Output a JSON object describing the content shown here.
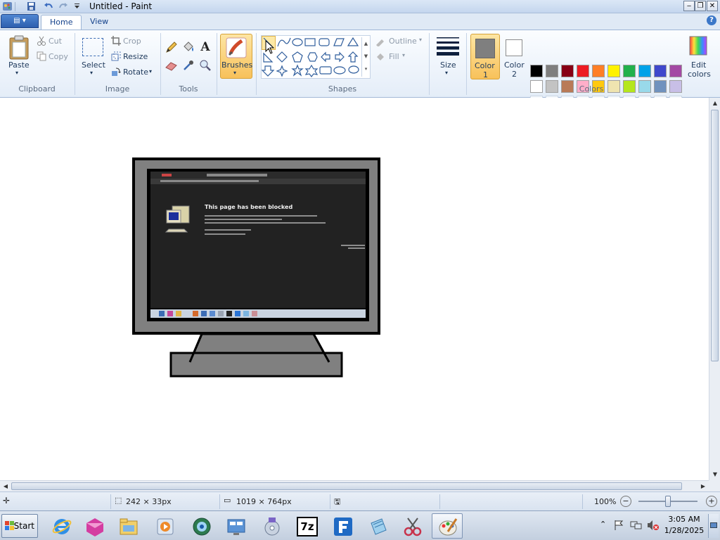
{
  "window": {
    "title": "Untitled - Paint"
  },
  "quick_access": [
    "save-icon",
    "undo-icon",
    "redo-icon",
    "customize-icon"
  ],
  "window_controls": [
    "minimize-icon",
    "restore-icon",
    "close-icon"
  ],
  "tabs": [
    {
      "label": "Home"
    },
    {
      "label": "View"
    }
  ],
  "ribbon": {
    "clipboard": {
      "label": "Clipboard",
      "paste": "Paste",
      "cut": "Cut",
      "copy": "Copy"
    },
    "image": {
      "label": "Image",
      "select": "Select",
      "crop": "Crop",
      "resize": "Resize",
      "rotate": "Rotate"
    },
    "tools": {
      "label": "Tools"
    },
    "brushes": {
      "label": "Brushes"
    },
    "shapes": {
      "label": "Shapes",
      "outline": "Outline",
      "fill": "Fill"
    },
    "size": {
      "label": "Size"
    },
    "colors": {
      "label": "Colors",
      "color1_line1": "Color",
      "color1_line2": "1",
      "color2_line1": "Color",
      "color2_line2": "2",
      "edit_line1": "Edit",
      "edit_line2": "colors",
      "color1_value": "#7f7f7f",
      "color2_value": "#ffffff",
      "palette_row1": [
        "#000000",
        "#7f7f7f",
        "#880015",
        "#ed1c24",
        "#ff7f27",
        "#fff200",
        "#22b14c",
        "#00a2e8",
        "#3f48cc",
        "#a349a4"
      ],
      "palette_row2": [
        "#ffffff",
        "#c3c3c3",
        "#b97a57",
        "#ffaec9",
        "#ffc90e",
        "#efe4b0",
        "#b5e61d",
        "#99d9ea",
        "#7092be",
        "#c8bfe7"
      ]
    }
  },
  "canvas": {
    "drawing": "monitor",
    "screen": {
      "heading": "This page has been blocked"
    }
  },
  "statusbar": {
    "selection_size": "242 × 33px",
    "image_size": "1019 × 764px",
    "zoom": "100%"
  },
  "taskbar": {
    "start": "Start",
    "items": [
      "ie-icon",
      "media-icon",
      "explorer-icon",
      "player-icon",
      "network-icon",
      "control-panel-icon",
      "install-icon",
      "sevenzip-icon",
      "filezilla-icon",
      "notepad-icon",
      "snipping-icon",
      "paint-icon"
    ],
    "time": "3:05 AM",
    "date": "1/28/2025"
  }
}
